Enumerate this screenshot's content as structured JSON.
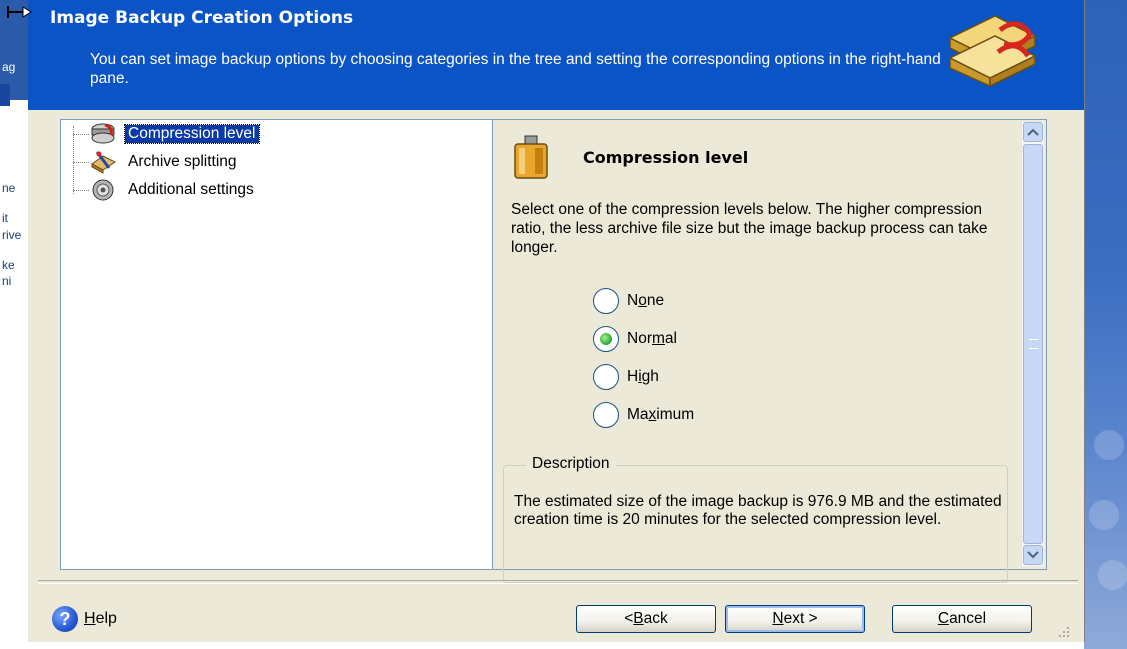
{
  "window": {
    "title": "Image Backup Creation Options",
    "description": "You can set image backup options by choosing categories in the tree and setting the corresponding options in the right-hand pane."
  },
  "background_fragments": [
    "ag",
    "ne",
    "it",
    "rive",
    "ke",
    "ni"
  ],
  "tree": {
    "items": [
      {
        "label": "Compression level",
        "icon": "compression-disks-icon",
        "selected": true
      },
      {
        "label": "Archive splitting",
        "icon": "archive-split-icon",
        "selected": false
      },
      {
        "label": "Additional settings",
        "icon": "settings-disc-icon",
        "selected": false
      }
    ]
  },
  "panel": {
    "title": "Compression level",
    "icon": "compression-press-icon",
    "description": "Select one of the compression levels below. The higher compression ratio, the less archive file size but the image backup process can take longer.",
    "options": [
      {
        "pre": "N",
        "mnemonic": "o",
        "post": "ne",
        "checked": false
      },
      {
        "pre": "Nor",
        "mnemonic": "m",
        "post": "al",
        "checked": true
      },
      {
        "pre": "H",
        "mnemonic": "i",
        "post": "gh",
        "checked": false
      },
      {
        "pre": "Ma",
        "mnemonic": "x",
        "post": "imum",
        "checked": false
      }
    ],
    "groupbox_title": "Description",
    "groupbox_text": "The estimated size of the image backup is 976.9 MB and the estimated creation time is 20 minutes for the selected compression level."
  },
  "footer": {
    "help_mnemonic": "H",
    "help_rest": "elp",
    "back_pre": "< ",
    "back_mnemonic": "B",
    "back_post": "ack",
    "next_mnemonic": "N",
    "next_post": "ext >",
    "cancel_mnemonic": "C",
    "cancel_post": "ancel"
  },
  "colors": {
    "header_blue": "#0b54c6",
    "dialog_bg": "#ece9d8",
    "selection": "#0b3aa6"
  }
}
